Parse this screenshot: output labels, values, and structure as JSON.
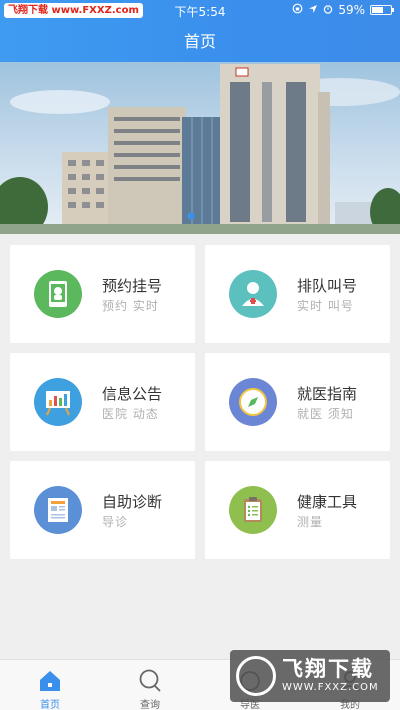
{
  "status_bar": {
    "watermark": "飞翔下载 www.FXXZ.com",
    "time": "下午5:54",
    "battery": "59%",
    "battery_level": 0.59
  },
  "header": {
    "title": "首页"
  },
  "cards": [
    {
      "title": "预约挂号",
      "subtitle": "预约 实时",
      "icon": "tablet-doctor-icon",
      "color": "#5bb85d"
    },
    {
      "title": "排队叫号",
      "subtitle": "实时 叫号",
      "icon": "nurse-icon",
      "color": "#5bc0be"
    },
    {
      "title": "信息公告",
      "subtitle": "医院 动态",
      "icon": "presentation-board-icon",
      "color": "#3fa0e0"
    },
    {
      "title": "就医指南",
      "subtitle": "就医 须知",
      "icon": "compass-icon",
      "color": "#6c86d6"
    },
    {
      "title": "自助诊断",
      "subtitle": "导诊",
      "icon": "document-icon",
      "color": "#5b8fd6"
    },
    {
      "title": "健康工具",
      "subtitle": "测量",
      "icon": "clipboard-icon",
      "color": "#8fbf4f"
    }
  ],
  "tabbar": {
    "items": [
      {
        "label": "首页",
        "icon": "home-icon",
        "active": true
      },
      {
        "label": "查询",
        "icon": "search-icon",
        "active": false
      },
      {
        "label": "导医",
        "icon": "guide-icon",
        "active": false
      },
      {
        "label": "我的",
        "icon": "user-icon",
        "active": false
      }
    ]
  },
  "watermark_logo": {
    "text": "飞翔下载",
    "url": "WWW.FXXZ.COM"
  },
  "colors": {
    "accent": "#3a8fec"
  }
}
